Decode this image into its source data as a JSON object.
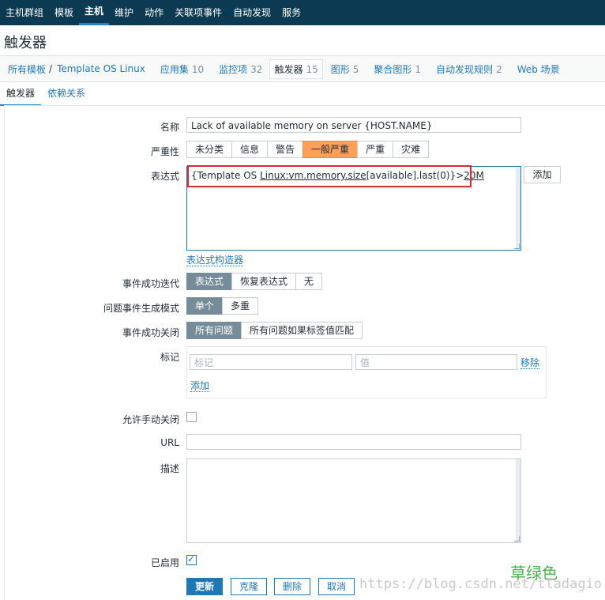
{
  "topnav": {
    "items": [
      "主机群组",
      "模板",
      "主机",
      "维护",
      "动作",
      "关联项事件",
      "自动发现",
      "服务"
    ],
    "active_index": 2
  },
  "page_title": "触发器",
  "breadcrumb": {
    "all_templates": "所有模板",
    "separator": "/",
    "template": "Template OS Linux",
    "items": [
      {
        "label": "应用集",
        "count": "10"
      },
      {
        "label": "监控项",
        "count": "32"
      },
      {
        "label": "触发器",
        "count": "15"
      },
      {
        "label": "图形",
        "count": "5"
      },
      {
        "label": "聚合图形",
        "count": "1"
      },
      {
        "label": "自动发现规则",
        "count": "2"
      },
      {
        "label": "Web 场景",
        "count": ""
      }
    ],
    "selected_index": 2
  },
  "tabs": [
    "触发器",
    "依赖关系"
  ],
  "form": {
    "name_label": "名称",
    "name_value": "Lack of available memory on server {HOST.NAME}",
    "severity_label": "严重性",
    "severity_options": [
      "未分类",
      "信息",
      "警告",
      "一般严重",
      "严重",
      "灾难"
    ],
    "severity_selected_index": 3,
    "expression_label": "表达式",
    "expression_parts": [
      "{Template OS ",
      "Linux:vm.memory.size",
      "[available].last(0)}>",
      "20M"
    ],
    "expression_add": "添加",
    "expression_builder": "表达式构造器",
    "ok_event_label": "事件成功迭代",
    "ok_event_options": [
      "表达式",
      "恢复表达式",
      "无"
    ],
    "problem_mode_label": "问题事件生成模式",
    "problem_mode_options": [
      "单个",
      "多重"
    ],
    "ok_close_label": "事件成功关闭",
    "ok_close_options": [
      "所有问题",
      "所有问题如果标签值匹配"
    ],
    "tags_label": "标记",
    "tag_placeholder": "标记",
    "value_placeholder": "值",
    "tag_remove": "移除",
    "tag_add": "添加",
    "manual_close_label": "允许手动关闭",
    "url_label": "URL",
    "description_label": "描述",
    "enabled_label": "已启用",
    "enabled_checkmark": "✓",
    "buttons": {
      "update": "更新",
      "clone": "克隆",
      "delete": "删除",
      "cancel": "取消"
    }
  },
  "watermark": "https://blog.csdn.net/tladagio",
  "watermark_cn": "草绿色",
  "colors": {
    "nav_bg": "#0b3a52",
    "link": "#1f78b4",
    "severity_selected": "#ffa059",
    "highlight": "#d9282e"
  }
}
